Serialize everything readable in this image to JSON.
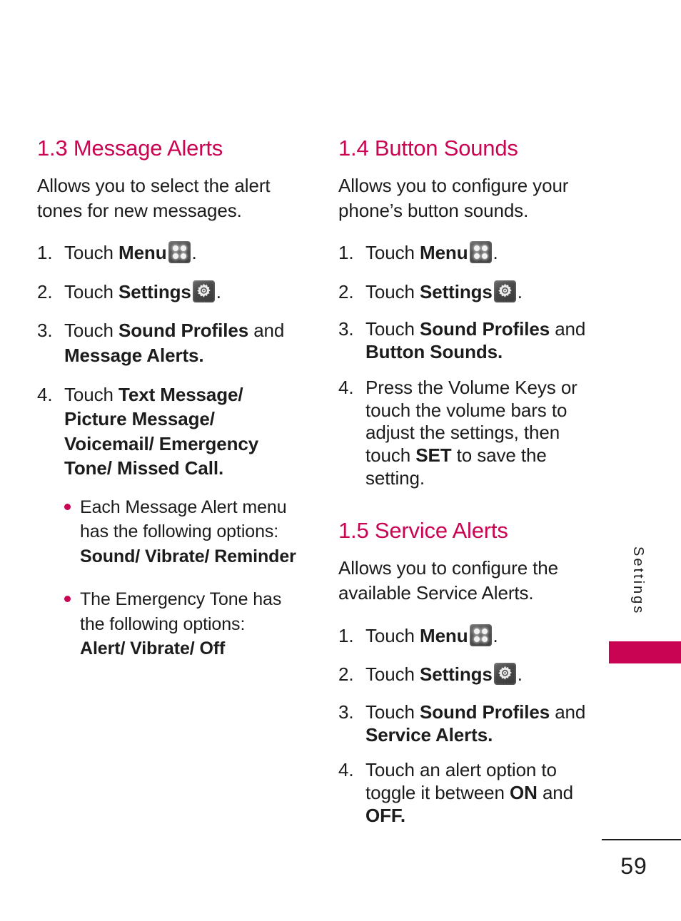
{
  "page": {
    "number": "59",
    "side_tab_label": "Settings",
    "accent_color": "#c90452",
    "text_color": "#1c1c1c",
    "background_color": "#ffffff"
  },
  "icons": {
    "menu": "menu-grid-icon",
    "settings": "gear-icon"
  },
  "left_column": {
    "heading": "1.3 Message Alerts",
    "intro": "Allows you to select the alert tones for new messages.",
    "steps": [
      {
        "number": "1.",
        "pre": "Touch ",
        "bold": "Menu",
        "icon": "menu",
        "post": "."
      },
      {
        "number": "2.",
        "pre": "Touch ",
        "bold": "Settings",
        "icon": "settings",
        "post": "."
      },
      {
        "number": "3.",
        "pre": "Touch ",
        "bold": "Sound Profiles",
        "mid": " and ",
        "bold2": "Message Alerts",
        "post": "."
      },
      {
        "number": "4.",
        "pre": "Touch ",
        "bold": "Text Message/ Picture Message/ Voicemail/ Emergency Tone/ Missed Call",
        "post": "."
      }
    ],
    "bullets": [
      {
        "text": "Each Message Alert menu has the following options:",
        "bold_line": "Sound/ Vibrate/ Reminder"
      },
      {
        "text": "The Emergency Tone has the following options:",
        "bold_line": "Alert/ Vibrate/ Off"
      }
    ]
  },
  "right_column": {
    "section_button_sounds": {
      "heading": "1.4 Button Sounds",
      "intro": "Allows you to configure your phone’s button sounds.",
      "steps": [
        {
          "number": "1.",
          "pre": "Touch ",
          "bold": "Menu",
          "icon": "menu",
          "post": "."
        },
        {
          "number": "2.",
          "pre": "Touch ",
          "bold": "Settings",
          "icon": "settings",
          "post": "."
        },
        {
          "number": "3.",
          "pre": "Touch ",
          "bold": "Sound Profiles",
          "mid": " and ",
          "bold2": "Button Sounds",
          "post": "."
        },
        {
          "number": "4.",
          "pre": "Press the Volume Keys or touch the volume bars to adjust the settings, then touch ",
          "bold": "SET",
          "post": " to save the setting."
        }
      ]
    },
    "section_service_alerts": {
      "heading": "1.5 Service Alerts",
      "intro": "Allows you to configure the available Service Alerts.",
      "steps": [
        {
          "number": "1.",
          "pre": "Touch ",
          "bold": "Menu",
          "icon": "menu",
          "post": "."
        },
        {
          "number": "2.",
          "pre": "Touch ",
          "bold": "Settings",
          "icon": "settings",
          "post": "."
        },
        {
          "number": "3.",
          "pre": "Touch ",
          "bold": "Sound Profiles",
          "mid": " and ",
          "bold2": "Service Alerts",
          "post": "."
        },
        {
          "number": "4.",
          "pre": "Touch an alert option to toggle it between ",
          "bold": "ON",
          "mid": " and ",
          "bold2": "OFF",
          "post": "."
        }
      ]
    }
  }
}
